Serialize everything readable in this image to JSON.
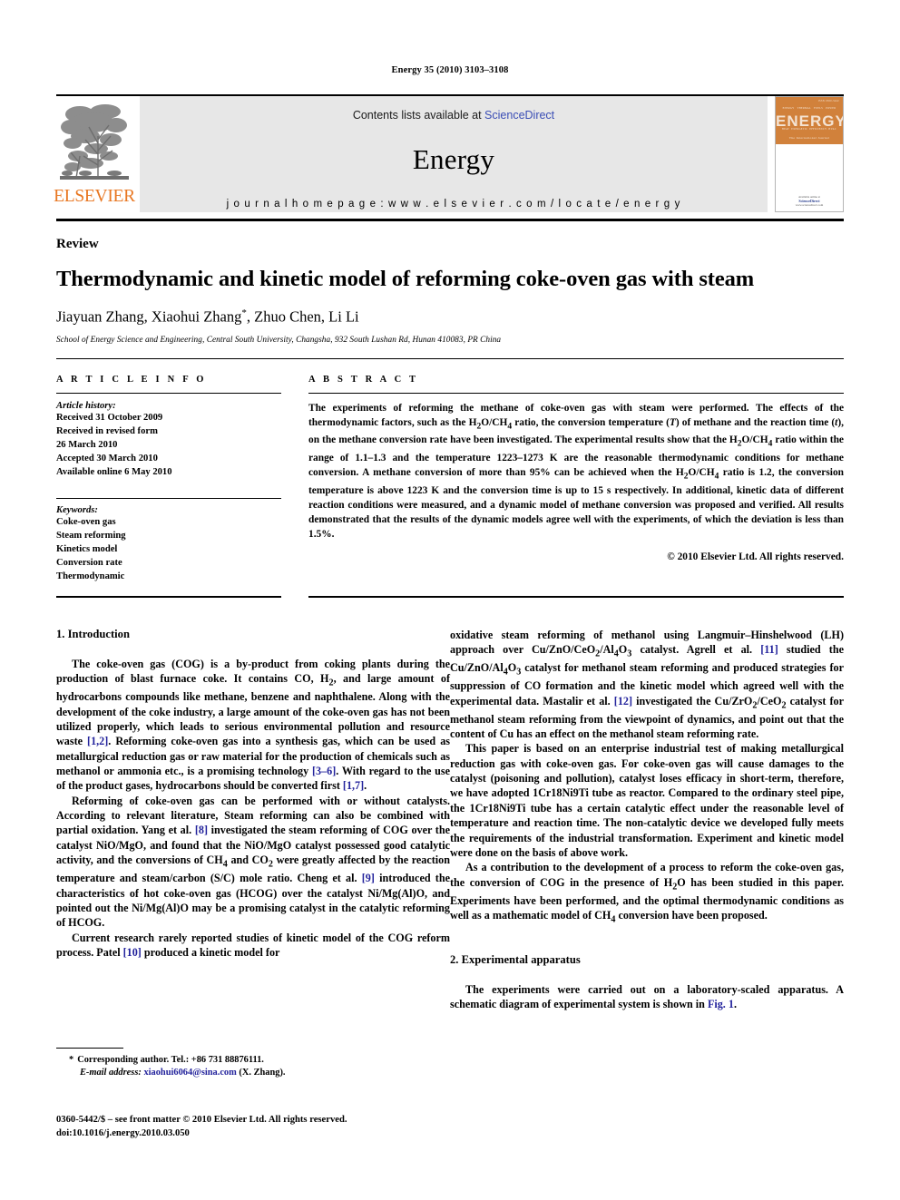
{
  "running_head": "Energy 35 (2010) 3103–3108",
  "masthead": {
    "publisher_logo_text": "ELSEVIER",
    "contents_prefix": "Contents lists available at ",
    "contents_link": "ScienceDirect",
    "journal_name": "Energy",
    "homepage_line": "j o u r n a l   h o m e p a g e :   w w w . e l s e v i e r . c o m / l o c a t e / e n e r g y",
    "cover": {
      "title": "ENERGY",
      "top_right_label": "ISSN 0360-5442",
      "row1": [
        "ENERGY",
        "THERMAL",
        "FUELS",
        "POWER"
      ],
      "row2": [
        "HEAT",
        "EXERGETIC",
        "EFFICIENCY",
        "HVAC"
      ],
      "tagline": "The International Journal",
      "footer_prefix": "Available online at",
      "footer_link": "ScienceDirect",
      "footer_url": "www.sciencedirect.com"
    },
    "accent_color": "#E87722",
    "cover_color": "#D1813B",
    "link_color": "#3a4db5"
  },
  "doctype": "Review",
  "title": "Thermodynamic and kinetic model of reforming coke-oven gas with steam",
  "authors_pre": "Jiayuan Zhang, Xiaohui Zhang",
  "authors_star": "*",
  "authors_post": ", Zhuo Chen, Li Li",
  "affiliation": "School of Energy Science and Engineering, Central South University, Changsha, 932 South Lushan Rd, Hunan 410083, PR China",
  "article_info": {
    "kicker": "A R T I C L E  I N F O",
    "history_head": "Article history:",
    "history": [
      "Received 31 October 2009",
      "Received in revised form",
      "26 March 2010",
      "Accepted 30 March 2010",
      "Available online 6 May 2010"
    ],
    "keywords_head": "Keywords:",
    "keywords": [
      "Coke-oven gas",
      "Steam reforming",
      "Kinetics model",
      "Conversion rate",
      "Thermodynamic"
    ]
  },
  "abstract": {
    "kicker": "A B S T R A C T",
    "part1": "The experiments of reforming the methane of coke-oven gas with steam were performed. The effects of the thermodynamic factors, such as the H",
    "sub1": "2",
    "part2": "O/CH",
    "sub2": "4",
    "part3": " ratio, the conversion temperature (",
    "ital_T": "T",
    "part4": ") of methane and the reaction time (",
    "ital_t": "t",
    "part5": "), on the methane conversion rate have been investigated. The experimental results show that the H",
    "part6": "O/CH",
    "part7": " ratio within the range of 1.1–1.3 and the temperature 1223–1273 K are the reasonable thermodynamic conditions for methane conversion. A methane conversion of more than 95% can be achieved when the H",
    "part8": "O/CH",
    "part9": " ratio is 1.2, the conversion temperature is above 1223 K and the conversion time is up to 15 s respectively. In additional, kinetic data of different reaction conditions were measured, and a dynamic model of methane conversion was proposed and verified. All results demonstrated that the results of the dynamic models agree well with the experiments, of which the deviation is less than 1.5%.",
    "copyright": "© 2010 Elsevier Ltd. All rights reserved."
  },
  "sections": {
    "intro_head": "1.  Introduction",
    "experimental_head": "2.  Experimental apparatus"
  },
  "body": {
    "left_p1_a": "The coke-oven gas (COG) is a by-product from coking plants during the production of blast furnace coke. It contains CO, H",
    "left_p1_b": ", and large amount of hydrocarbons compounds like methane, benzene and naphthalene. Along with the development of the coke industry, a large amount of the coke-oven gas has not been utilized properly, which leads to serious environmental pollution and resource waste ",
    "left_p1_ref1": "[1,2]",
    "left_p1_c": ". Reforming coke-oven gas into a synthesis gas, which can be used as metallurgical reduction gas or raw material for the production of chemicals such as methanol or ammonia etc., is a promising technology ",
    "left_p1_ref2": "[3–6]",
    "left_p1_d": ". With regard to the use of the product gases, hydrocarbons should be converted first ",
    "left_p1_ref3": "[1,7]",
    "left_p1_e": ".",
    "left_p2_a": "Reforming of coke-oven gas can be performed with or without catalysts. According to relevant literature, Steam reforming can also be combined with partial oxidation. Yang et al. ",
    "left_p2_ref1": "[8]",
    "left_p2_b": " investigated the steam reforming of COG over the catalyst NiO/MgO, and found that the NiO/MgO catalyst possessed good catalytic activity, and the conversions of CH",
    "left_p2_sub1": "4",
    "left_p2_c": " and CO",
    "left_p2_sub2": "2",
    "left_p2_d": " were greatly affected by the reaction temperature and steam/carbon (S/C) mole ratio. Cheng et al. ",
    "left_p2_ref2": "[9]",
    "left_p2_e": " introduced the characteristics of hot coke-oven gas (HCOG) over the catalyst Ni/Mg(Al)O, and pointed out the Ni/Mg(Al)O may be a promising catalyst in the catalytic reforming of HCOG.",
    "left_p3_a": "Current research rarely reported studies of kinetic model of the COG reform process. Patel ",
    "left_p3_ref1": "[10]",
    "left_p3_b": " produced a kinetic model for",
    "right_p1_a": "oxidative steam reforming of methanol using Langmuir–Hinshelwood (LH) approach over Cu/ZnO/CeO",
    "right_p1_b": "/Al",
    "right_p1_c": "O",
    "right_p1_d": " catalyst. Agrell et al. ",
    "right_p1_ref1": "[11]",
    "right_p1_e": " studied the Cu/ZnO/Al",
    "right_p1_f": "O",
    "right_p1_g": " catalyst for methanol steam reforming and produced strategies for suppression of CO formation and the kinetic model which agreed well with the experimental data. Mastalir et al. ",
    "right_p1_ref2": "[12]",
    "right_p1_h": " investigated the Cu/ZrO",
    "right_p1_i": "/CeO",
    "right_p1_j": " catalyst for methanol steam reforming from the viewpoint of dynamics, and point out that the content of Cu has an effect on the methanol steam reforming rate.",
    "right_p2": "This paper is based on an enterprise industrial test of making metallurgical reduction gas with coke-oven gas. For coke-oven gas will cause damages to the catalyst (poisoning and pollution), catalyst loses efficacy in short-term, therefore, we have adopted 1Cr18Ni9Ti tube as reactor. Compared to the ordinary steel pipe, the 1Cr18Ni9Ti tube has a certain catalytic effect under the reasonable level of temperature and reaction time. The non-catalytic device we developed fully meets the requirements of the industrial transformation. Experiment and kinetic model were done on the basis of above work.",
    "right_p3_a": "As a contribution to the development of a process to reform the coke-oven gas, the conversion of COG in the presence of H",
    "right_p3_b": "O has been studied in this paper. Experiments have been performed, and the optimal thermodynamic conditions as well as a mathematic model of CH",
    "right_p3_c": " conversion have been proposed.",
    "right_p4_a": "The experiments were carried out on a laboratory-scaled apparatus. A schematic diagram of experimental system is shown in ",
    "right_p4_fig": "Fig. 1",
    "right_p4_b": "."
  },
  "footnote": {
    "star": "*",
    "corresponding": "Corresponding author. Tel.: +86 731 88876111.",
    "email_label": "E-mail address:",
    "email": "xiaohui6064@sina.com",
    "email_suffix": "(X. Zhang)."
  },
  "imprint": {
    "line1": "0360-5442/$ – see front matter © 2010 Elsevier Ltd. All rights reserved.",
    "line2": "doi:10.1016/j.energy.2010.03.050"
  }
}
